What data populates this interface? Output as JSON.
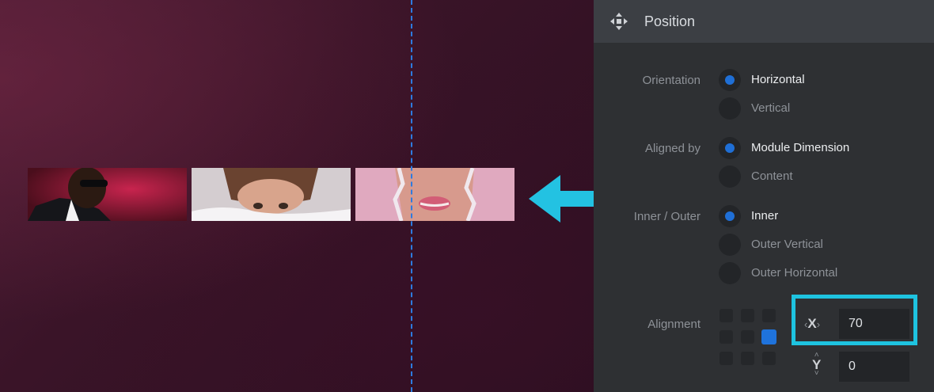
{
  "panel": {
    "title": "Position",
    "header_icon": "move-arrows-icon",
    "orientation": {
      "label": "Orientation",
      "options": [
        {
          "label": "Horizontal",
          "checked": true
        },
        {
          "label": "Vertical",
          "checked": false
        }
      ]
    },
    "aligned_by": {
      "label": "Aligned by",
      "options": [
        {
          "label": "Module Dimension",
          "checked": true
        },
        {
          "label": "Content",
          "checked": false
        }
      ]
    },
    "inner_outer": {
      "label": "Inner / Outer",
      "options": [
        {
          "label": "Inner",
          "checked": true
        },
        {
          "label": "Outer Vertical",
          "checked": false
        },
        {
          "label": "Outer Horizontal",
          "checked": false
        }
      ]
    },
    "alignment": {
      "label": "Alignment",
      "selected": "middle-right",
      "x": {
        "label": "X",
        "value": "70"
      },
      "y": {
        "label": "Y",
        "value": "0"
      }
    }
  },
  "colors": {
    "accent": "#1f6fd6",
    "highlight": "#1ec3e0",
    "guide": "#2d7be0"
  },
  "canvas": {
    "thumbnails": [
      "man-in-sunglasses",
      "woman-peeking-over-blanket",
      "torn-paper-lips"
    ],
    "arrow_icon": "left-arrow-icon"
  }
}
